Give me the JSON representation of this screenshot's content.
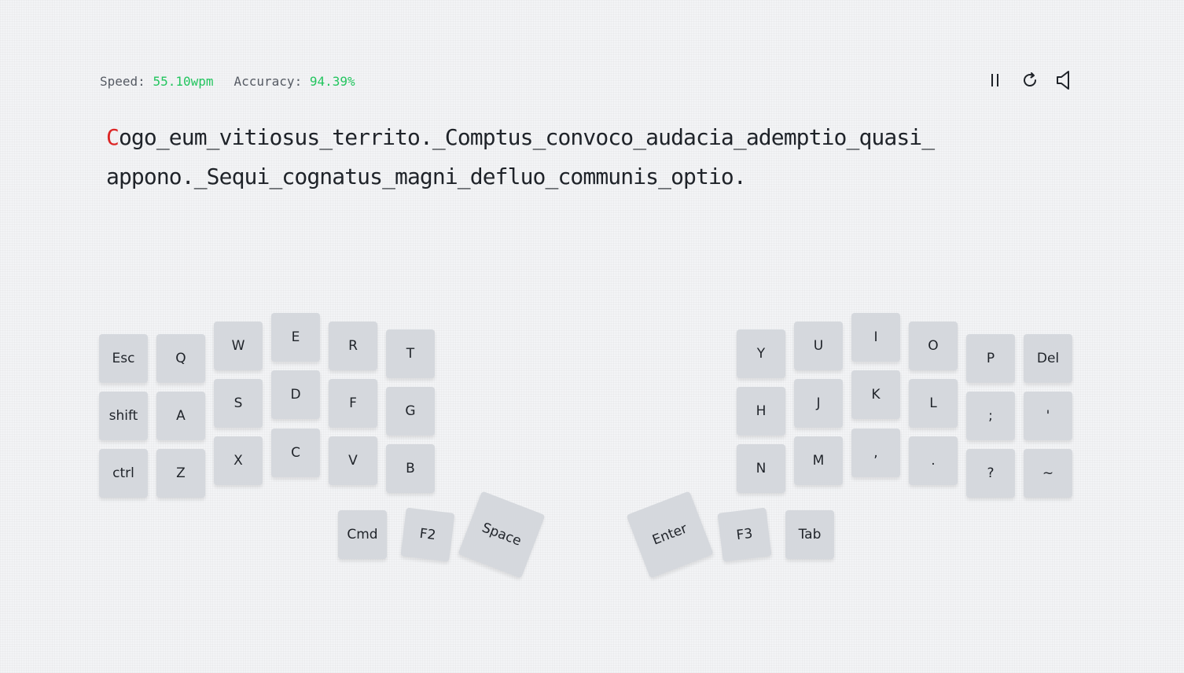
{
  "stats": {
    "speed_label": "Speed:",
    "speed_value": "55.10wpm",
    "accuracy_label": "Accuracy:",
    "accuracy_value": "94.39%",
    "value_color": "#22c55e"
  },
  "controls": {
    "icons": [
      "pause-icon",
      "restart-icon",
      "volume-icon"
    ]
  },
  "text": {
    "current_char": "C",
    "line1_rest": "ogo_eum_vitiosus_territo._Comptus_convoco_audacia_ademptio_quasi_",
    "line2": "appono._Sequi_cognatus_magni_defluo_communis_optio.",
    "current_char_color": "#dc2626"
  },
  "keyboard": {
    "left": {
      "esc": "Esc",
      "q": "Q",
      "w": "W",
      "e": "E",
      "r": "R",
      "t": "T",
      "shift": "shift",
      "a": "A",
      "s": "S",
      "d": "D",
      "f": "F",
      "g": "G",
      "ctrl": "ctrl",
      "z": "Z",
      "x": "X",
      "c": "C",
      "v": "V",
      "b": "B",
      "cmd": "Cmd",
      "f2": "F2",
      "space": "Space"
    },
    "right": {
      "y": "Y",
      "u": "U",
      "i": "I",
      "o": "O",
      "p": "P",
      "del": "Del",
      "h": "H",
      "j": "J",
      "k": "K",
      "l": "L",
      "semicolon": ";",
      "quote": "'",
      "n": "N",
      "m": "M",
      "comma": ",",
      "period": ".",
      "question": "?",
      "tilde": "~",
      "enter": "Enter",
      "f3": "F3",
      "tab": "Tab"
    },
    "key_color": "#d5d8dd"
  }
}
